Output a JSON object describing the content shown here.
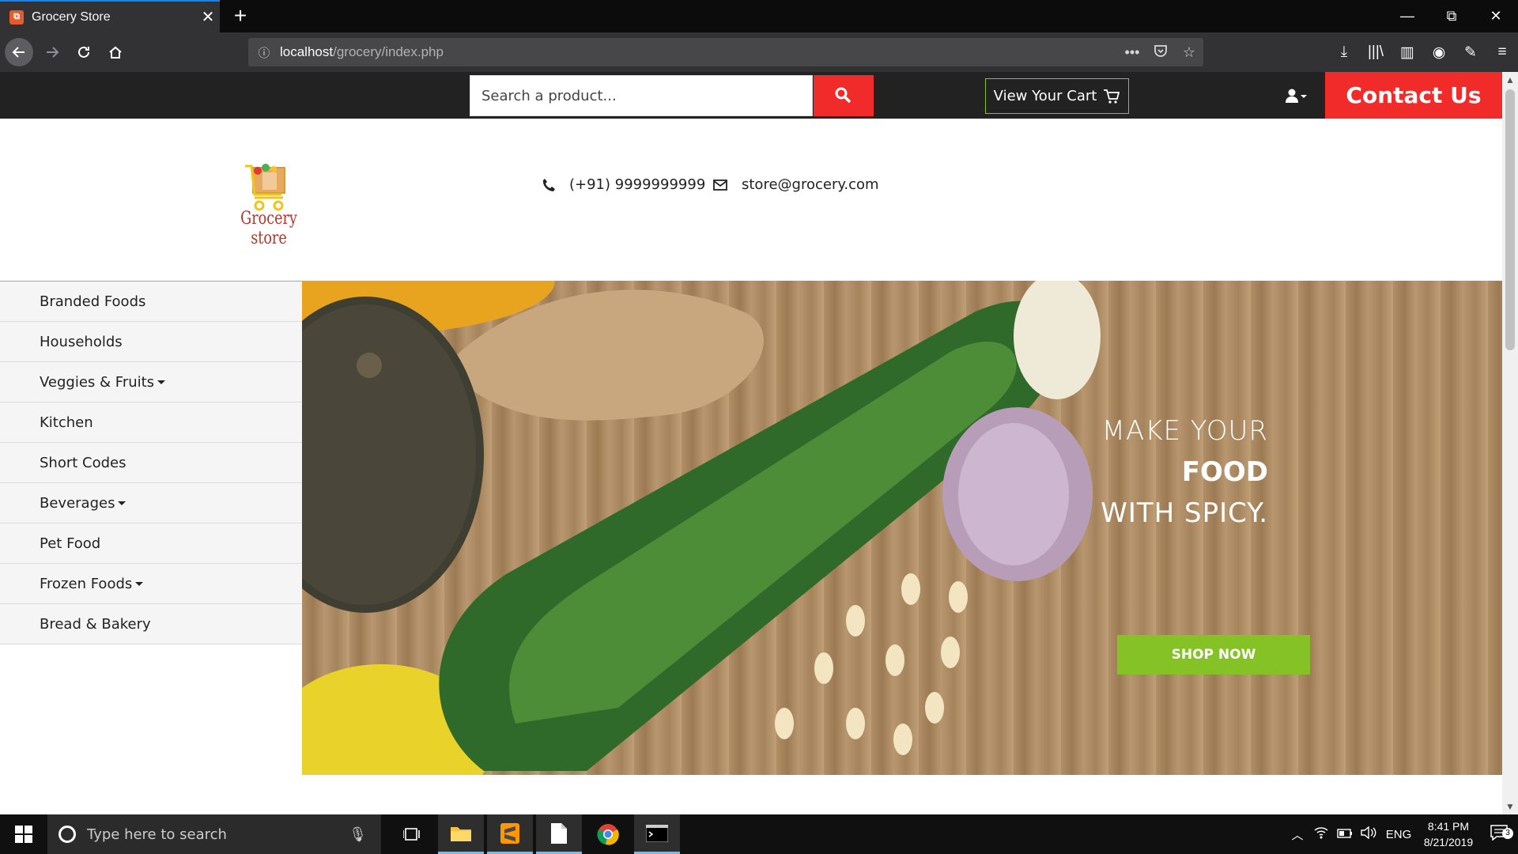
{
  "browser": {
    "tab_title": "Grocery Store",
    "favicon_letter": "⧉",
    "tab_close": "✕",
    "new_tab": "+",
    "url_host": "localhost",
    "url_path": "/grocery/index.php",
    "window": {
      "minimize": "—",
      "restore": "⧉",
      "close": "✕"
    }
  },
  "store": {
    "search_placeholder": "Search a product...",
    "cart_label": "View Your Cart",
    "contact_label": "Contact Us",
    "logo_text": "Grocery store",
    "phone": "(+91) 9999999999",
    "email": "store@grocery.com",
    "accent_red": "#f12a2a",
    "accent_green": "#84c225"
  },
  "sidebar": {
    "items": [
      {
        "label": "Branded Foods"
      },
      {
        "label": "Households"
      },
      {
        "label": "Veggies & Fruits",
        "has_dropdown": true
      },
      {
        "label": "Kitchen"
      },
      {
        "label": "Short Codes"
      },
      {
        "label": "Beverages",
        "has_dropdown": true
      },
      {
        "label": "Pet Food"
      },
      {
        "label": "Frozen Foods",
        "has_dropdown": true
      },
      {
        "label": "Bread & Bakery"
      }
    ]
  },
  "banner": {
    "line1": "MAKE YOUR",
    "line2": "FOOD",
    "line3": "WITH SPICY.",
    "button": "SHOP NOW"
  },
  "taskbar": {
    "search_placeholder": "Type here to search",
    "language": "ENG",
    "time": "8:41 PM",
    "date": "8/21/2019",
    "notifications": "3"
  }
}
